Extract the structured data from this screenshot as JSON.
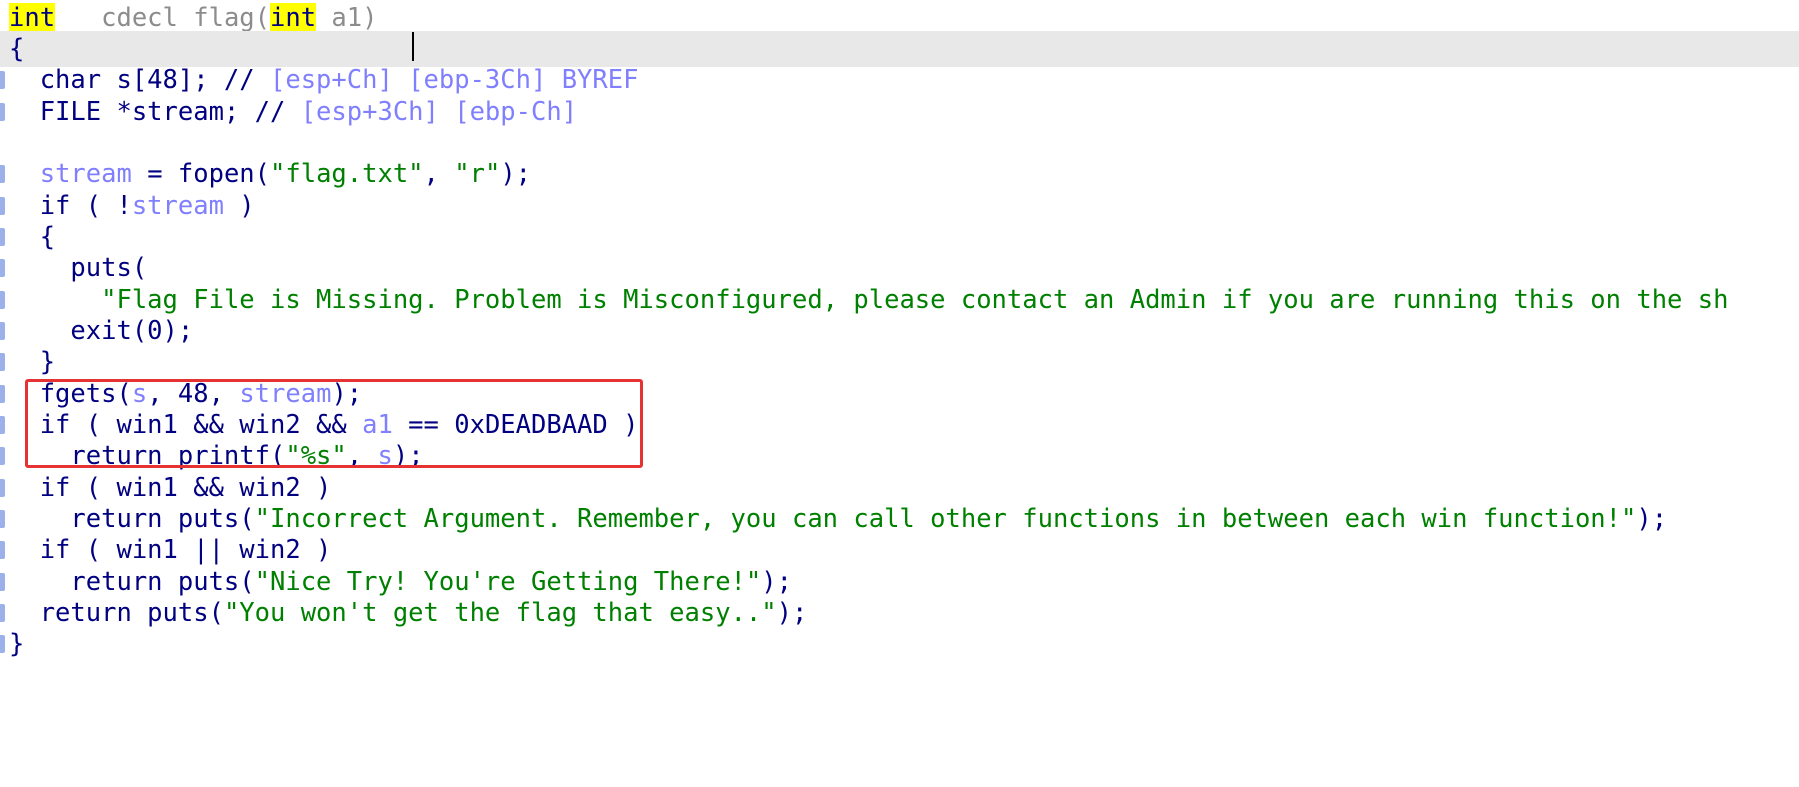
{
  "editor": {
    "lines": [
      {
        "tokens": [
          {
            "t": "int",
            "c": "hl"
          },
          {
            "t": " __cdecl flag(",
            "c": "gray"
          },
          {
            "t": "int",
            "c": "hl"
          },
          {
            "t": " a1)",
            "c": "gray"
          }
        ]
      },
      {
        "tokens": [
          {
            "t": "{",
            "c": "kw"
          }
        ]
      },
      {
        "tokens": [
          {
            "t": "  char s[48]; // ",
            "c": "kw"
          },
          {
            "t": "[esp+Ch] [ebp-3Ch] BYREF",
            "c": "var"
          }
        ]
      },
      {
        "tokens": [
          {
            "t": "  FILE *stream; // ",
            "c": "kw"
          },
          {
            "t": "[esp+3Ch] [ebp-Ch]",
            "c": "var"
          }
        ]
      },
      {
        "tokens": [
          {
            "t": "",
            "c": "kw"
          }
        ]
      },
      {
        "tokens": [
          {
            "t": "  ",
            "c": "kw"
          },
          {
            "t": "stream",
            "c": "var"
          },
          {
            "t": " = fopen(",
            "c": "kw"
          },
          {
            "t": "\"flag.txt\"",
            "c": "str"
          },
          {
            "t": ", ",
            "c": "kw"
          },
          {
            "t": "\"r\"",
            "c": "str"
          },
          {
            "t": ");",
            "c": "kw"
          }
        ]
      },
      {
        "tokens": [
          {
            "t": "  if ( !",
            "c": "kw"
          },
          {
            "t": "stream",
            "c": "var"
          },
          {
            "t": " )",
            "c": "kw"
          }
        ]
      },
      {
        "tokens": [
          {
            "t": "  {",
            "c": "kw"
          }
        ]
      },
      {
        "tokens": [
          {
            "t": "    puts(",
            "c": "kw"
          }
        ]
      },
      {
        "tokens": [
          {
            "t": "      ",
            "c": "kw"
          },
          {
            "t": "\"Flag File is Missing. Problem is Misconfigured, please contact an Admin if you are running this on the sh",
            "c": "str"
          }
        ]
      },
      {
        "tokens": [
          {
            "t": "    exit(0);",
            "c": "kw"
          }
        ]
      },
      {
        "tokens": [
          {
            "t": "  }",
            "c": "kw"
          }
        ]
      },
      {
        "tokens": [
          {
            "t": "  fgets(",
            "c": "kw"
          },
          {
            "t": "s",
            "c": "var"
          },
          {
            "t": ", 48, ",
            "c": "kw"
          },
          {
            "t": "stream",
            "c": "var"
          },
          {
            "t": ");",
            "c": "kw"
          }
        ]
      },
      {
        "tokens": [
          {
            "t": "  if ( win1 && win2 && ",
            "c": "kw"
          },
          {
            "t": "a1",
            "c": "var"
          },
          {
            "t": " == 0xDEADBAAD )",
            "c": "kw"
          }
        ]
      },
      {
        "tokens": [
          {
            "t": "    return printf(",
            "c": "kw"
          },
          {
            "t": "\"%s\"",
            "c": "str"
          },
          {
            "t": ", ",
            "c": "kw"
          },
          {
            "t": "s",
            "c": "var"
          },
          {
            "t": ");",
            "c": "kw"
          }
        ]
      },
      {
        "tokens": [
          {
            "t": "  if ( win1 && win2 )",
            "c": "kw"
          }
        ]
      },
      {
        "tokens": [
          {
            "t": "    return puts(",
            "c": "kw"
          },
          {
            "t": "\"Incorrect Argument. Remember, you can call other functions in between each win function!\"",
            "c": "str"
          },
          {
            "t": ");",
            "c": "kw"
          }
        ]
      },
      {
        "tokens": [
          {
            "t": "  if ( win1 || win2 )",
            "c": "kw"
          }
        ]
      },
      {
        "tokens": [
          {
            "t": "    return puts(",
            "c": "kw"
          },
          {
            "t": "\"Nice Try! You're Getting There!\"",
            "c": "str"
          },
          {
            "t": ");",
            "c": "kw"
          }
        ]
      },
      {
        "tokens": [
          {
            "t": "  return puts(",
            "c": "kw"
          },
          {
            "t": "\"You won't get the flag that easy..\"",
            "c": "str"
          },
          {
            "t": ");",
            "c": "kw"
          }
        ]
      },
      {
        "tokens": [
          {
            "t": "}",
            "c": "kw"
          }
        ]
      }
    ],
    "current_line_index": 1,
    "highlighted_block_lines": [
      12,
      13,
      14
    ],
    "colors": {
      "keyword": "#000080",
      "variable": "#8080ff",
      "string": "#008000",
      "signature": "#8c8c8c",
      "identifier_highlight": "#ffff00",
      "current_line": "#e8e8e8",
      "annotation_box": "#e53333"
    }
  }
}
